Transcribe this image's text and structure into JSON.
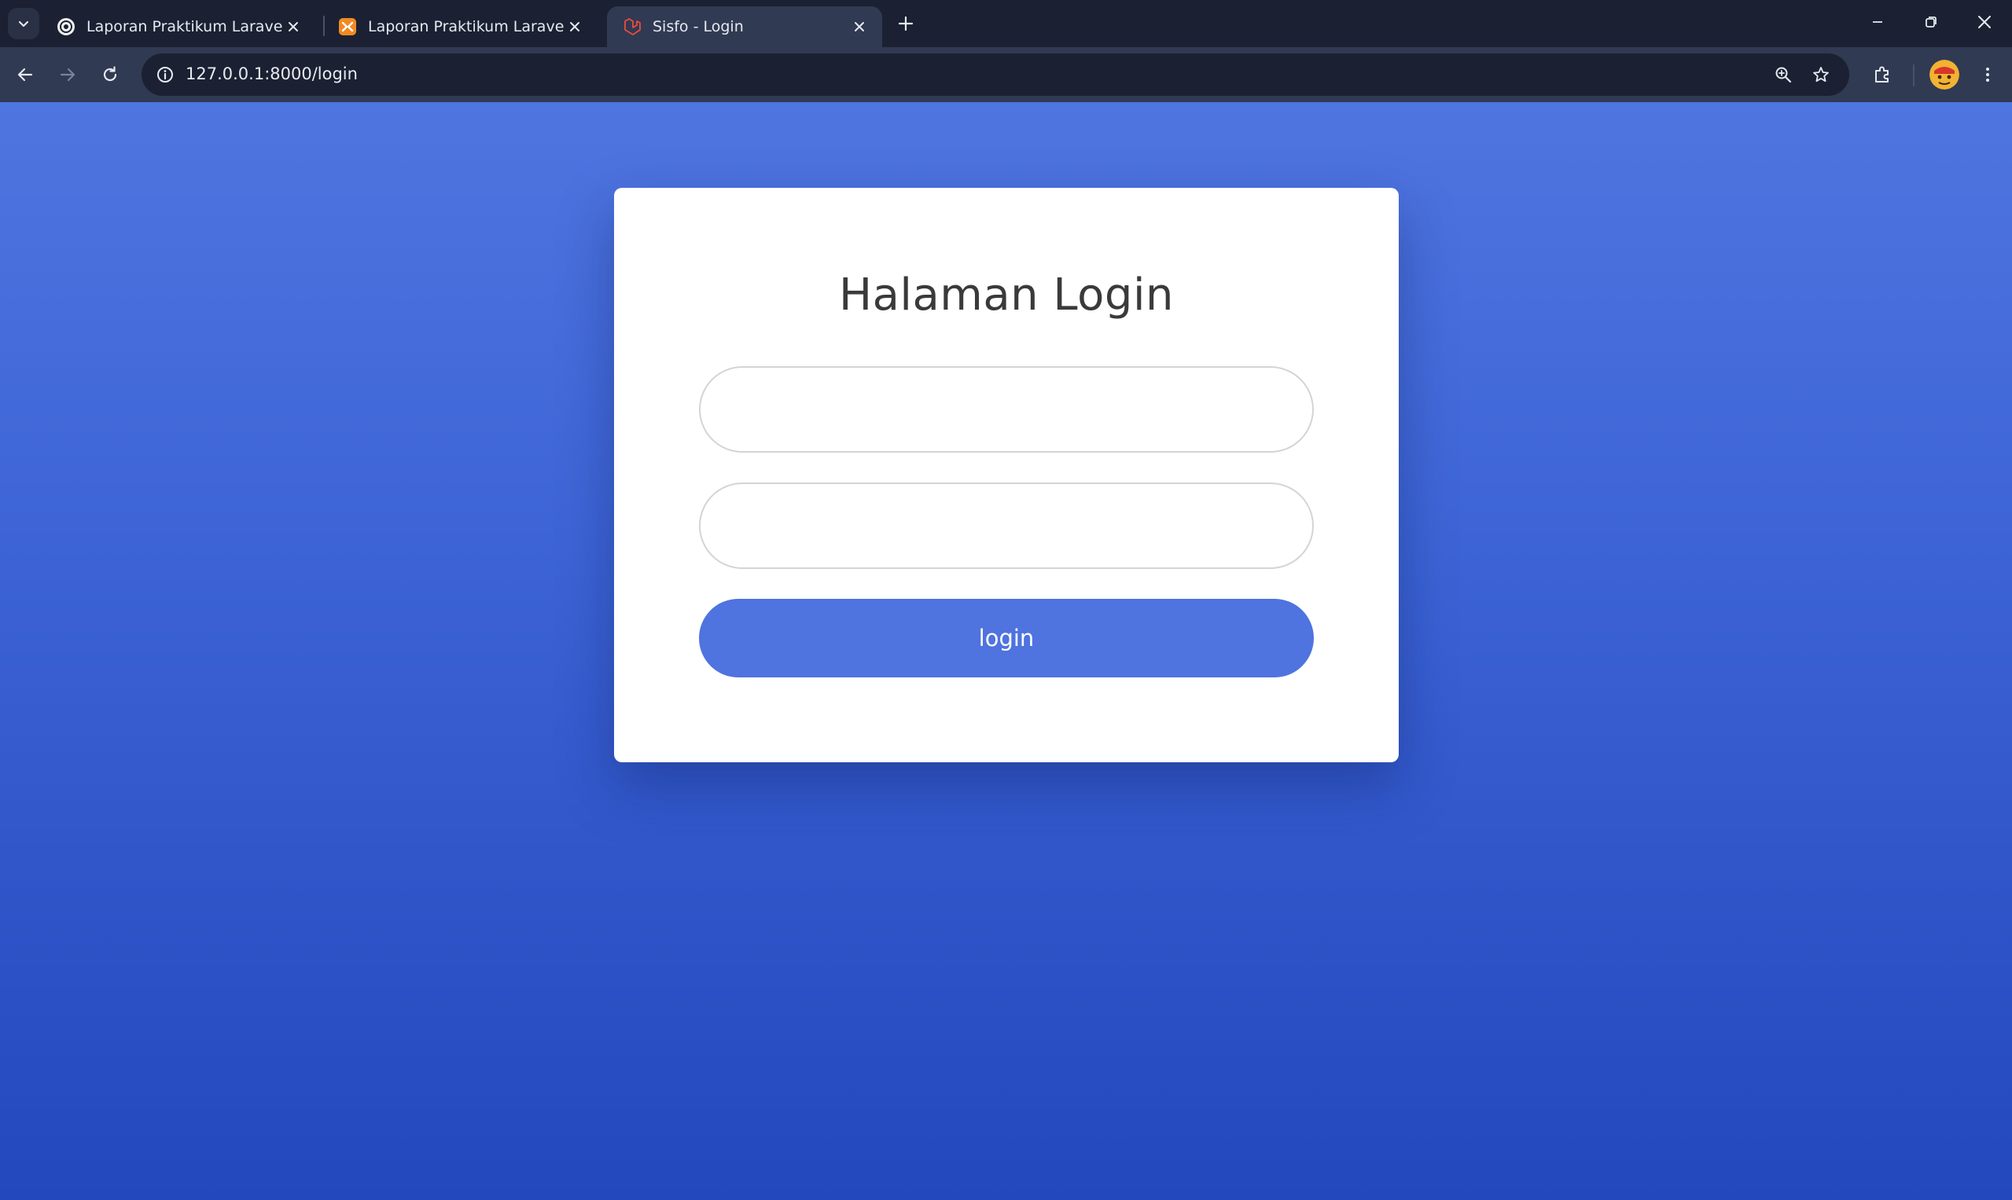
{
  "browser": {
    "tabs": [
      {
        "title": "Laporan Praktikum Laravel",
        "favicon": "github-icon",
        "active": false
      },
      {
        "title": "Laporan Praktikum Laravel",
        "favicon": "xampp-icon",
        "active": false
      },
      {
        "title": "Sisfo - Login",
        "favicon": "laravel-icon",
        "active": true
      }
    ],
    "url": "127.0.0.1:8000/login"
  },
  "page": {
    "title": "Halaman Login",
    "email_field": {
      "value": "",
      "placeholder": ""
    },
    "password_field": {
      "value": "",
      "placeholder": ""
    },
    "login_label": "login"
  },
  "colors": {
    "accent": "#4f73df",
    "background_top": "#4f75e0",
    "background_bottom": "#2347bd",
    "chrome_dark": "#1b2132",
    "chrome_toolbar": "#303a52"
  }
}
